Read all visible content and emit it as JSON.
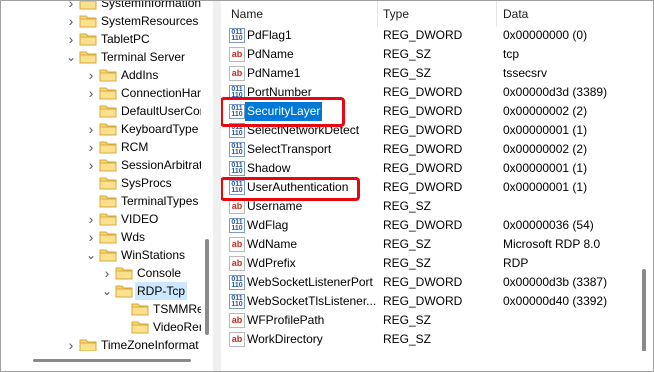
{
  "tree": {
    "items": [
      {
        "label": "SystemInformation",
        "expander": "collapsed"
      },
      {
        "label": "SystemResources",
        "expander": "collapsed"
      },
      {
        "label": "TabletPC",
        "expander": "collapsed"
      },
      {
        "label": "Terminal Server",
        "expander": "expanded"
      },
      {
        "label": "AddIns",
        "expander": "collapsed"
      },
      {
        "label": "ConnectionHar",
        "expander": "collapsed"
      },
      {
        "label": "DefaultUserCon",
        "expander": "none"
      },
      {
        "label": "KeyboardType M",
        "expander": "collapsed"
      },
      {
        "label": "RCM",
        "expander": "collapsed"
      },
      {
        "label": "SessionArbitrati",
        "expander": "collapsed"
      },
      {
        "label": "SysProcs",
        "expander": "none"
      },
      {
        "label": "TerminalTypes",
        "expander": "none"
      },
      {
        "label": "VIDEO",
        "expander": "collapsed"
      },
      {
        "label": "Wds",
        "expander": "collapsed"
      },
      {
        "label": "WinStations",
        "expander": "expanded"
      },
      {
        "label": "Console",
        "expander": "collapsed"
      },
      {
        "label": "RDP-Tcp",
        "expander": "expanded"
      },
      {
        "label": "TSMMRer",
        "expander": "none"
      },
      {
        "label": "VideoRen",
        "expander": "none"
      },
      {
        "label": "TimeZoneInformat",
        "expander": "collapsed"
      }
    ]
  },
  "list": {
    "headers": {
      "name": "Name",
      "type": "Type",
      "data": "Data"
    },
    "rows": [
      {
        "icon": "dword",
        "name": "PdFlag1",
        "type": "REG_DWORD",
        "data": "0x00000000 (0)"
      },
      {
        "icon": "sz",
        "name": "PdName",
        "type": "REG_SZ",
        "data": "tcp"
      },
      {
        "icon": "sz",
        "name": "PdName1",
        "type": "REG_SZ",
        "data": "tssecsrv"
      },
      {
        "icon": "dword",
        "name": "PortNumber",
        "type": "REG_DWORD",
        "data": "0x00000d3d (3389)"
      },
      {
        "icon": "dword",
        "name": "SecurityLayer",
        "type": "REG_DWORD",
        "data": "0x00000002 (2)"
      },
      {
        "icon": "dword",
        "name": "SelectNetworkDetect",
        "type": "REG_DWORD",
        "data": "0x00000001 (1)"
      },
      {
        "icon": "dword",
        "name": "SelectTransport",
        "type": "REG_DWORD",
        "data": "0x00000002 (2)"
      },
      {
        "icon": "dword",
        "name": "Shadow",
        "type": "REG_DWORD",
        "data": "0x00000001 (1)"
      },
      {
        "icon": "dword",
        "name": "UserAuthentication",
        "type": "REG_DWORD",
        "data": "0x00000001 (1)"
      },
      {
        "icon": "sz",
        "name": "Username",
        "type": "REG_SZ",
        "data": ""
      },
      {
        "icon": "dword",
        "name": "WdFlag",
        "type": "REG_DWORD",
        "data": "0x00000036 (54)"
      },
      {
        "icon": "sz",
        "name": "WdName",
        "type": "REG_SZ",
        "data": "Microsoft RDP 8.0"
      },
      {
        "icon": "sz",
        "name": "WdPrefix",
        "type": "REG_SZ",
        "data": "RDP"
      },
      {
        "icon": "dword",
        "name": "WebSocketListenerPort",
        "type": "REG_DWORD",
        "data": "0x00000d3b (3387)"
      },
      {
        "icon": "dword",
        "name": "WebSocketTlsListener...",
        "type": "REG_DWORD",
        "data": "0x00000d40 (3392)"
      },
      {
        "icon": "sz",
        "name": "WFProfilePath",
        "type": "REG_SZ",
        "data": ""
      },
      {
        "icon": "sz",
        "name": "WorkDirectory",
        "type": "REG_SZ",
        "data": ""
      }
    ]
  },
  "icons": {
    "sz_glyph": "ab",
    "dword_glyph": "011\n110"
  },
  "colors": {
    "selection": "#0078d7",
    "tree_selection": "#cce8ff",
    "highlight": "#e8060f",
    "folder": "#f8d775"
  }
}
